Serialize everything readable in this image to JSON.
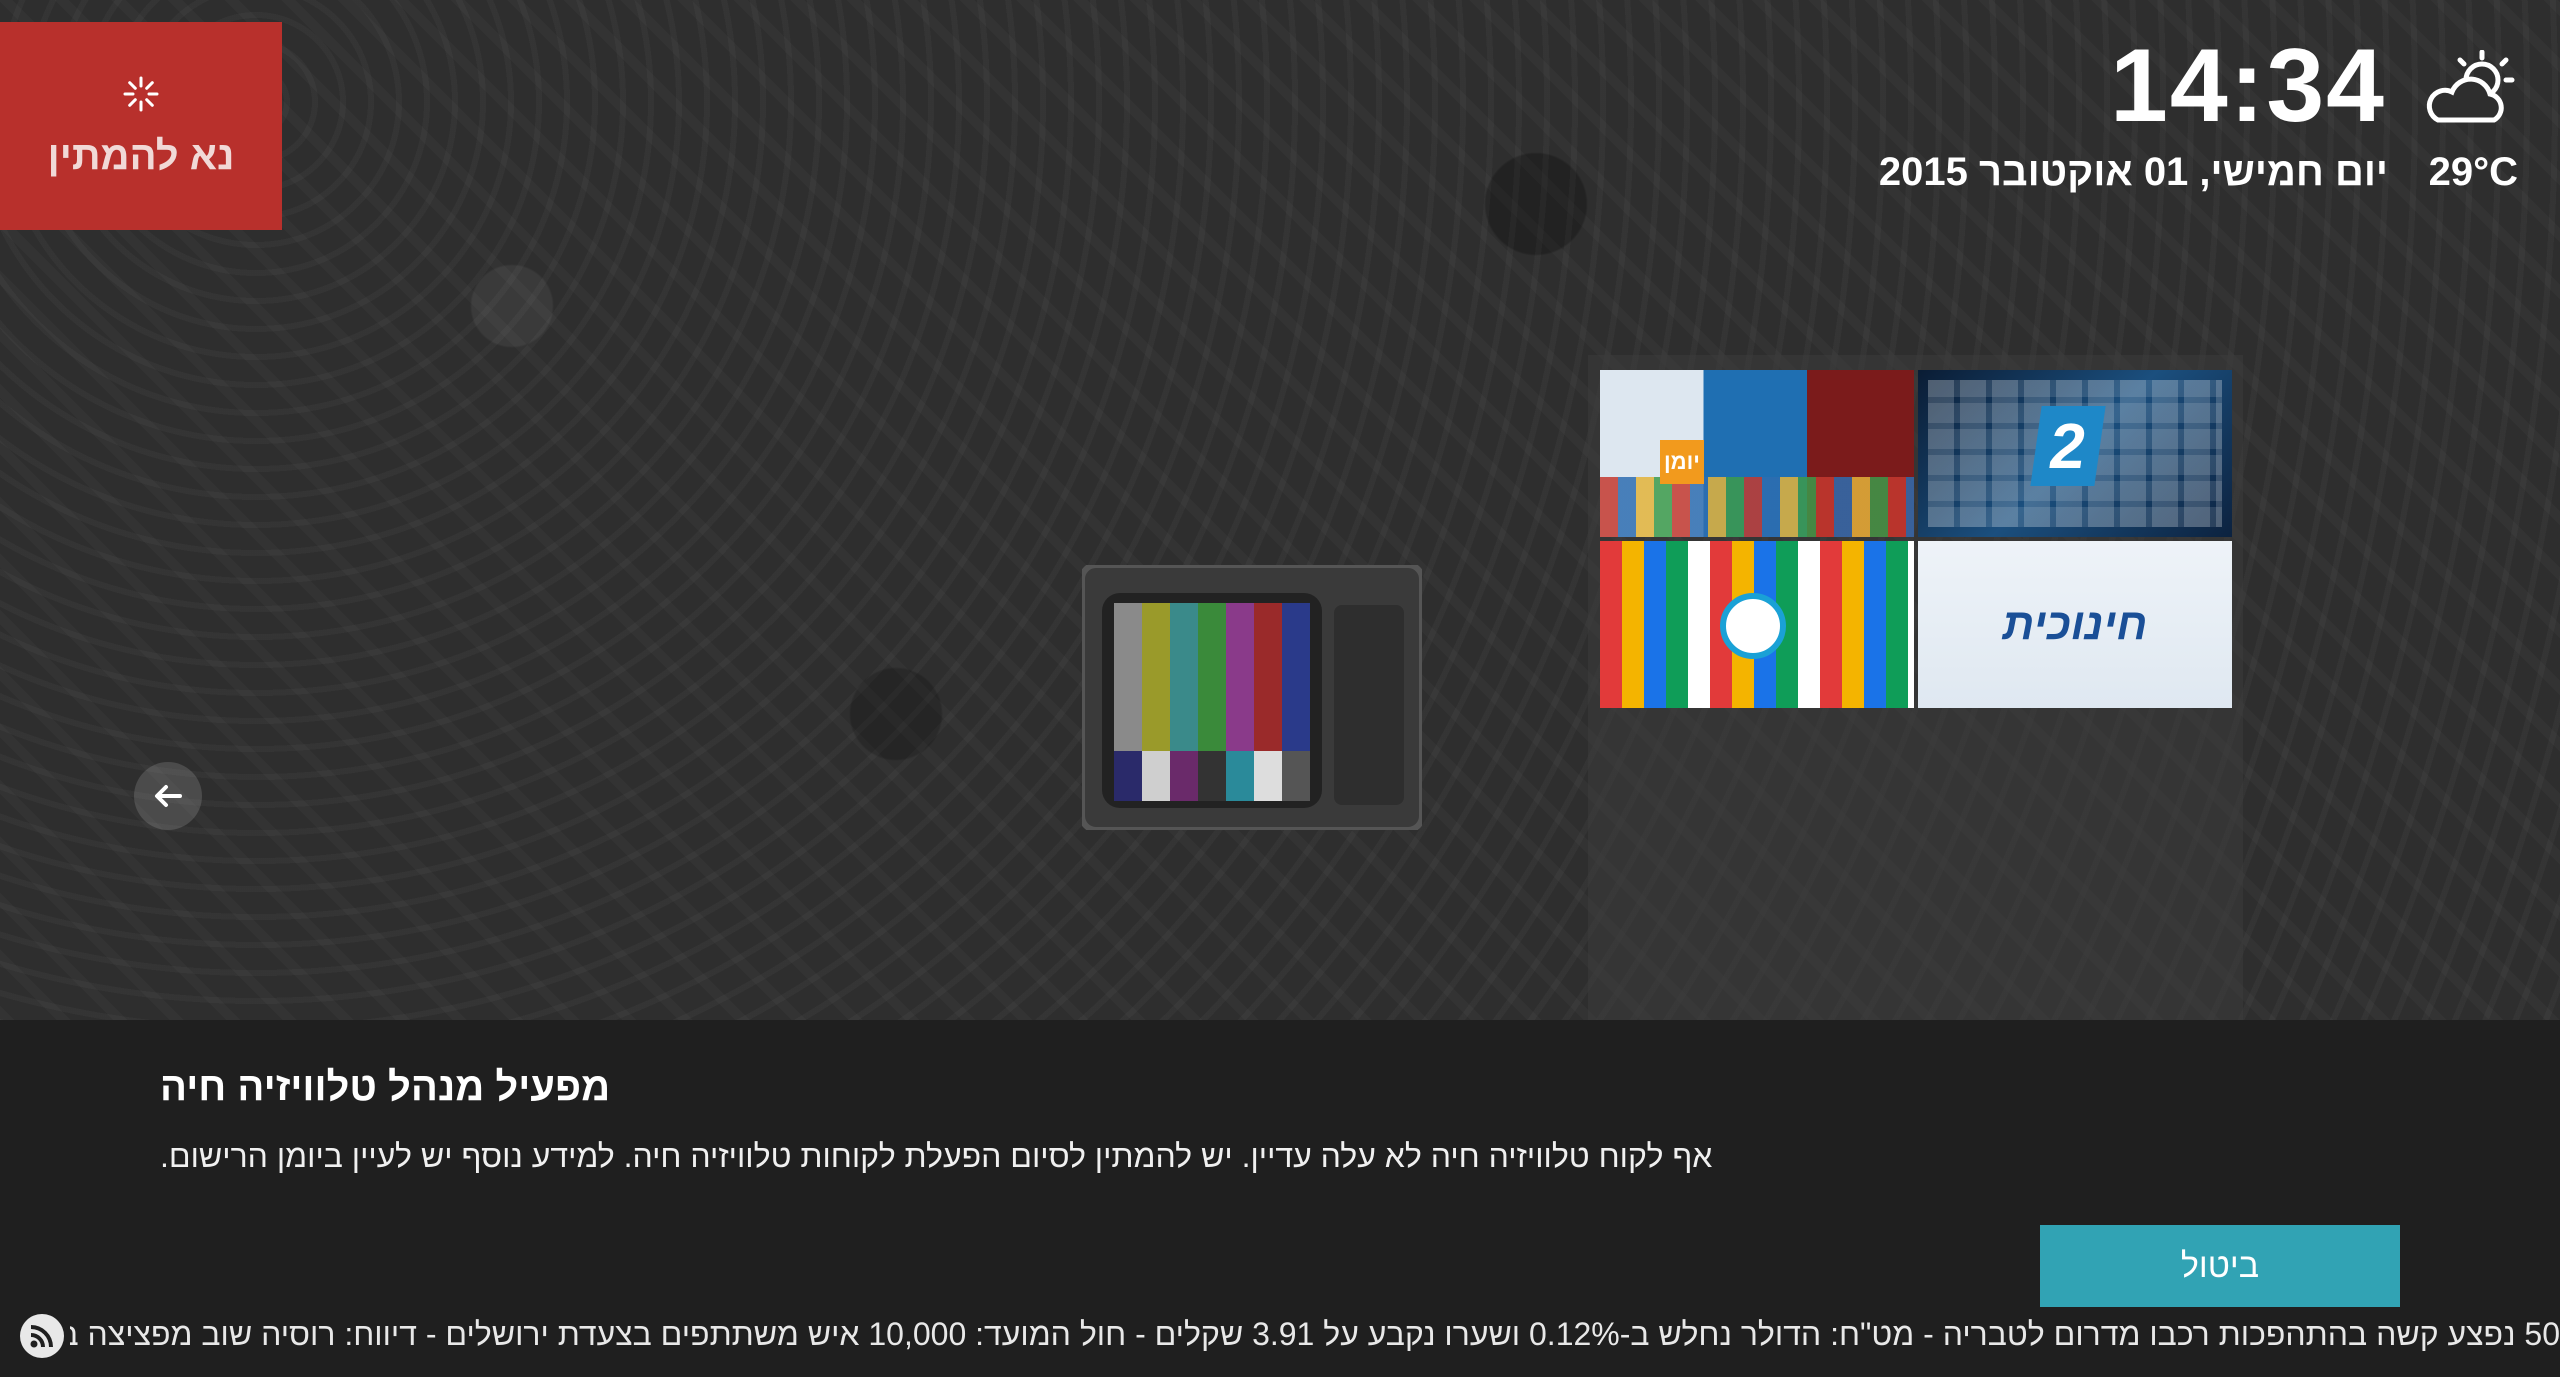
{
  "busy_indicator": {
    "label": "נא להמתין"
  },
  "header": {
    "time": "14:34",
    "date": "יום חמישי, 01 אוקטובר 2015",
    "temperature": "29°C",
    "weather_icon": "partly-cloudy-day-icon"
  },
  "thumbnails": {
    "yoman_tag": "יומן",
    "channel_logo": "חינוכית"
  },
  "dialog": {
    "title": "מפעיל מנהל טלוויזיה חיה",
    "message": "אף לקוח טלוויזיה חיה לא עלה עדיין. יש להמתין לסיום הפעלת לקוחות טלוויזיה חיה. למידע נוסף יש לעיין ביומן הרישום.",
    "cancel_label": "ביטול"
  },
  "ticker": {
    "text": "50 נפצע קשה בהתהפכות רכבו מדרום לטבריה - מט\"ח: הדולר נחלש ב-0.12% ושערו נקבע על 3.91 שקלים - חול המועד: 10,000 איש משתתפים בצעדת ירושלים - דיווח: רוסיה שוב מפציצה בסוריה ואף"
  },
  "colors": {
    "busy_bg": "#b8302c",
    "dialog_bg": "#1f1f1f",
    "button_accent": "#31a3b4"
  }
}
